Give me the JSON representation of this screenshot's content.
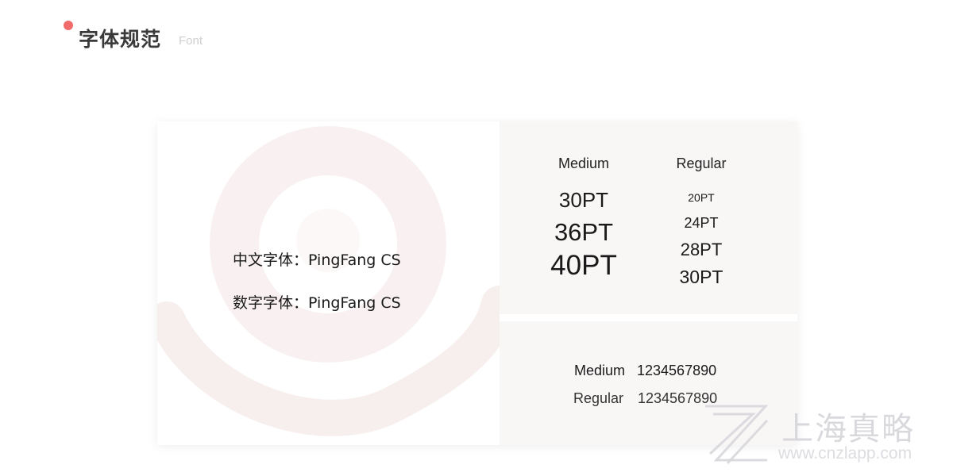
{
  "header": {
    "title": "字体规范",
    "subtitle": "Font"
  },
  "fonts": {
    "chinese": "中文字体：PingFang CS",
    "numeric": "数字字体：PingFang CS"
  },
  "sizes": {
    "medium": {
      "label": "Medium",
      "items": [
        "30PT",
        "36PT",
        "40PT"
      ]
    },
    "regular": {
      "label": "Regular",
      "items": [
        "20PT",
        "24PT",
        "28PT",
        "30PT"
      ]
    }
  },
  "numerals": {
    "medium_label": "Medium",
    "medium_value": "1234567890",
    "regular_label": "Regular",
    "regular_value": "1234567890"
  },
  "watermark": {
    "brand": "上海真略",
    "url": "www.cnzlapp.com",
    "logo_icon": "zl-logo-icon"
  },
  "colors": {
    "accent_dot": "#f26b6b",
    "panel_bg": "#f9f6f6",
    "swirl": "#f7eded"
  }
}
